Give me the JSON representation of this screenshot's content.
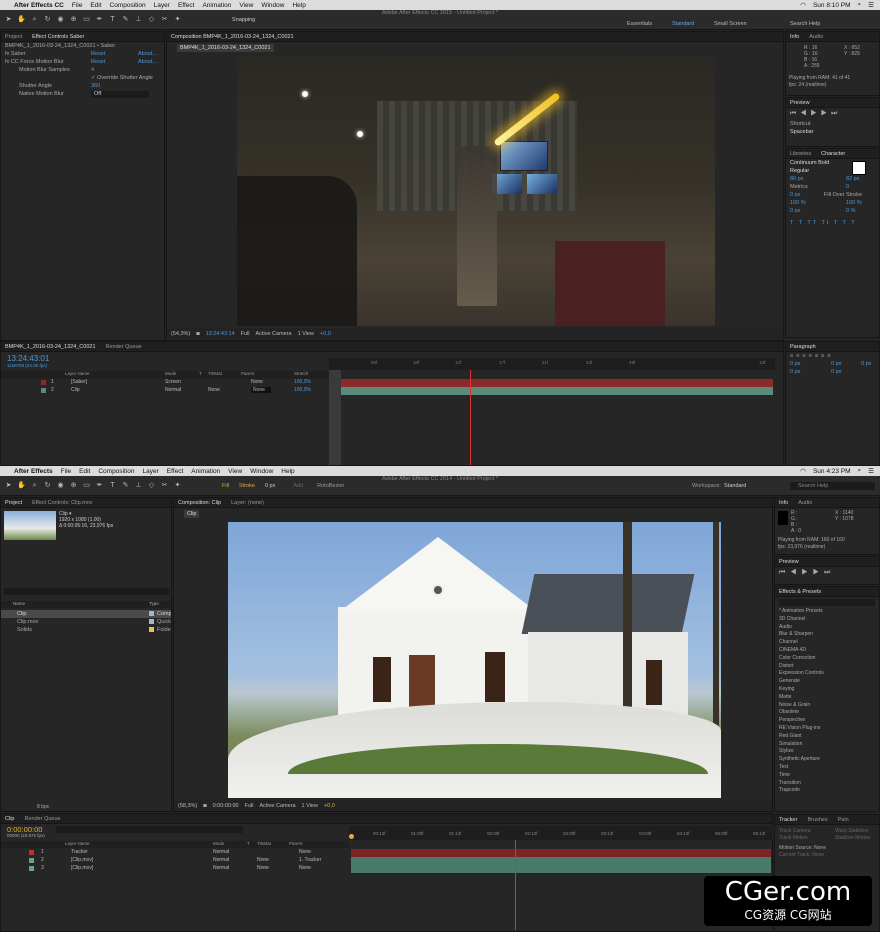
{
  "top": {
    "menu": {
      "app": "After Effects CC",
      "items": [
        "File",
        "Edit",
        "Composition",
        "Layer",
        "Effect",
        "Animation",
        "View",
        "Window",
        "Help"
      ],
      "clock": "Sun 8:10 PM"
    },
    "window_title": "Adobe After Effects CC 2015 - Untitled Project *",
    "snapping": "Snapping",
    "workspaces": [
      "Essentials",
      "Standard",
      "Small Screen"
    ],
    "search": "Search Help",
    "left_tabs": [
      "Project",
      "Effect Controls Saber"
    ],
    "effect_path": "BMP4K_1_2016-03-24_1324_C0021 • Saber",
    "effects": [
      {
        "name": "Saber",
        "reset": "Reset",
        "about": "About..."
      },
      {
        "name": "CC Force Motion Blur",
        "reset": "Reset",
        "about": "About..."
      }
    ],
    "fx_props": [
      {
        "label": "Motion Blur Samples",
        "value": "4"
      },
      {
        "label": "Override Shutter Angle",
        "value": ""
      },
      {
        "label": "Shutter Angle",
        "value": "360"
      },
      {
        "label": "Native Motion Blur",
        "value": "Off"
      }
    ],
    "comp_tab": "Composition BMP4K_1_2016-03-24_1324_C0021",
    "comp_chip": "BMP4K_1_2016-03-24_1324_C0021",
    "viewer_bar": [
      "(54,3%)",
      "13:24:43:14",
      "Full",
      "Active Camera",
      "1 View",
      "+0,0"
    ],
    "info": {
      "tabs": [
        "Info",
        "Audio"
      ],
      "r": "R : 16",
      "g": "G : 16",
      "b": "B : 16",
      "a": "A : 255",
      "x": "X : 652",
      "y": "Y : 829",
      "ram": "Playing from RAM: 41 of 41",
      "fps": "fps: 24 (realtime)"
    },
    "preview": {
      "tab": "Preview",
      "shortcut_label": "Shortcut",
      "shortcut": "Spacebar"
    },
    "character": {
      "tabs": [
        "Libraries",
        "Character"
      ],
      "font": "Continuum Bold",
      "style": "Regular",
      "size": "80 px",
      "leading": "82 px",
      "metrics": "Metrics",
      "tracking": "0",
      "stroke": "0 px",
      "stroke_mode": "Fill Over Stroke",
      "vscale": "100 %",
      "hscale": "100 %",
      "baseline": "0 px",
      "tsume": "0 %",
      "styles": [
        "T",
        "T",
        "TT",
        "Tt",
        "T",
        "T",
        "T"
      ]
    },
    "paragraph": {
      "tab": "Paragraph",
      "vals": [
        "0 px",
        "0 px",
        "0 px",
        "0 px",
        "0 px"
      ]
    },
    "timeline": {
      "tabs": [
        "BMP4K_1_2016-03-24_1324_C0021",
        "Render Queue"
      ],
      "time": "13:24:43:01",
      "frames": "1158793 (24.00 fps)",
      "cols": [
        "Layer Name",
        "Mode",
        "T",
        "TrkMat",
        "Parent",
        "Stretch"
      ],
      "layers": [
        {
          "num": "1",
          "name": "[Saber]",
          "mode": "Screen",
          "trk": "",
          "parent": "None",
          "stretch": "100,0%"
        },
        {
          "num": "2",
          "name": "Clip",
          "mode": "Normal",
          "trk": "None",
          "parent": "None",
          "stretch": "100,0%"
        }
      ],
      "ruler": [
        "00f",
        "10f",
        "12f",
        "17f",
        "21f",
        "43f",
        "49f",
        "13f"
      ]
    },
    "colors": {
      "accent": "#4a9ae0",
      "playhead": "#d33333",
      "layer_red": "#8a2a2a",
      "layer_teal": "#5a8a7a"
    }
  },
  "bot": {
    "menu": {
      "app": "After Effects",
      "items": [
        "File",
        "Edit",
        "Composition",
        "Layer",
        "Effect",
        "Animation",
        "View",
        "Window",
        "Help"
      ],
      "clock": "Sun 4:23 PM"
    },
    "window_title": "Adobe After Effects CC 2014 - Untitled Project *",
    "toolbar": {
      "fill": "Fill",
      "stroke": "Stroke",
      "stroke_px": "0 px",
      "add": "Add",
      "rotobezier": "RotoBezier",
      "workspace_label": "Workspace:",
      "workspace": "Standard",
      "search": "Search Help"
    },
    "project": {
      "tabs": [
        "Project",
        "Effect Controls: Clip.mov"
      ],
      "item": "Clip ▾",
      "dims": "1920 x 1080 (1,00)",
      "dur": "Δ 0:00:05:16, 23,976 fps",
      "cols": [
        "Name",
        "Type"
      ],
      "items": [
        {
          "name": "Clip",
          "type": "Comp",
          "color": "#a6b5c8"
        },
        {
          "name": "Clip.mov",
          "type": "Quick",
          "color": "#a6b5c8"
        },
        {
          "name": "Solids",
          "type": "Folder",
          "color": "#e3c44a"
        }
      ],
      "bpc": "8 bpc"
    },
    "comp": {
      "tab": "Composition: Clip",
      "layer_tab": "Layer: (none)",
      "chip": "Clip"
    },
    "viewer_bar": [
      "(58,3%)",
      "0:00:00:00",
      "Full",
      "Active Camera",
      "1 View",
      "+0,0"
    ],
    "info": {
      "tabs": [
        "Info",
        "Audio"
      ],
      "r": "R :",
      "g": "G :",
      "b": "B :",
      "a": "A : 0",
      "x": "X : 1140",
      "y": "Y : 1078",
      "ram": "Playing from RAM: 160 of 160",
      "fps": "fps: 23,976 (realtime)"
    },
    "preview": {
      "tab": "Preview"
    },
    "effects_presets": {
      "tab": "Effects & Presets",
      "items": [
        "* Animation Presets",
        "3D Channel",
        "Audio",
        "Blur & Sharpen",
        "Channel",
        "CINEMA 4D",
        "Color Correction",
        "Distort",
        "Expression Controls",
        "Generate",
        "Keying",
        "Matte",
        "Noise & Grain",
        "Obsolete",
        "Perspective",
        "RE:Vision Plug-ins",
        "Red Giant",
        "Simulation",
        "Stylize",
        "Synthetic Aperture",
        "Text",
        "Time",
        "Transition",
        "Trapcode"
      ]
    },
    "tracker": {
      "tabs": [
        "Tracker",
        "Brushes",
        "Pain"
      ],
      "buttons": [
        "Track Camera",
        "Warp Stabilizer",
        "Track Motion",
        "Stabilize Motion"
      ],
      "source_label": "Motion Source:",
      "source": "None",
      "current_label": "Current Track:",
      "current": "None"
    },
    "timeline": {
      "tabs": [
        "Clip",
        "Render Queue"
      ],
      "time": "0:00:00:00",
      "frames": "00000 (23.976 fps)",
      "cols": [
        "Layer Name",
        "Mode",
        "T",
        "TrkMat",
        "Parent"
      ],
      "layers": [
        {
          "num": "1",
          "name": "Tracker",
          "mode": "Normal",
          "trk": "",
          "parent": "None",
          "color": "#c03030"
        },
        {
          "num": "2",
          "name": "[Clip.mov]",
          "mode": "Normal",
          "trk": "None",
          "parent": "1. Tracker",
          "color": "#6aa090"
        },
        {
          "num": "3",
          "name": "[Clip.mov]",
          "mode": "Normal",
          "trk": "None",
          "parent": "None",
          "color": "#6aa090"
        }
      ],
      "ruler": [
        "00:12f",
        "01:00f",
        "01:12f",
        "02:00f",
        "02:12f",
        "03:00f",
        "03:12f",
        "04:00f",
        "04:12f",
        "05:00f",
        "05:12f"
      ]
    }
  },
  "watermark": {
    "line1": "CGer.com",
    "line2": "CG资源 CG网站"
  }
}
